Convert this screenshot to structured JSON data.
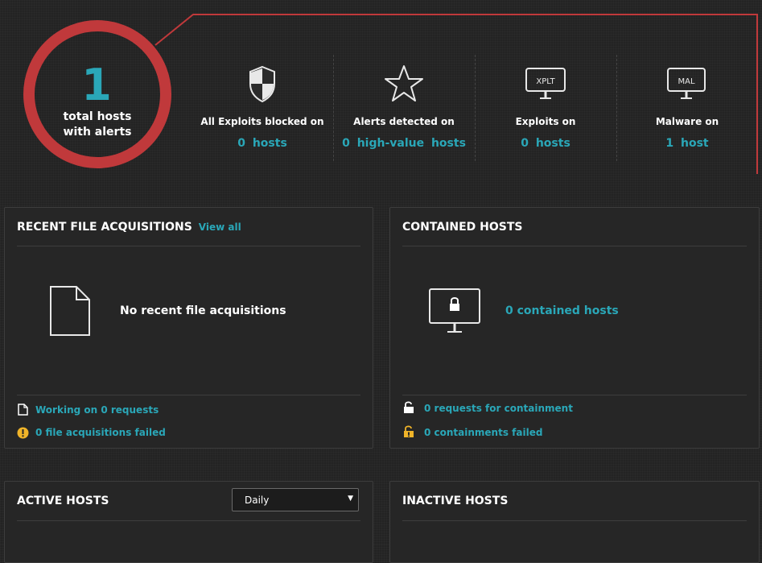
{
  "summary": {
    "total_count": "1",
    "total_label": "total hosts with alerts",
    "stats": [
      {
        "icon": "shield-icon",
        "label": "All Exploits blocked on",
        "value": "0  hosts"
      },
      {
        "icon": "star-icon",
        "label": "Alerts detected on",
        "value": "0  high-value hosts"
      },
      {
        "icon": "xplt-monitor-icon",
        "icon_text": "XPLT",
        "label": "Exploits on",
        "value": "0  hosts"
      },
      {
        "icon": "mal-monitor-icon",
        "icon_text": "MAL",
        "label": "Malware on",
        "value": "1  host"
      }
    ]
  },
  "recent_file": {
    "title": "RECENT FILE ACQUISITIONS",
    "view_all": "View all",
    "empty_message": "No recent file acquisitions",
    "working_on": "Working on 0 requests",
    "failed": "0 file acquisitions failed"
  },
  "contained": {
    "title": "CONTAINED HOSTS",
    "count_text": "0 contained hosts",
    "requests": "0 requests for containment",
    "failed": "0 containments failed"
  },
  "active_hosts": {
    "title": "ACTIVE HOSTS",
    "period": "Daily"
  },
  "inactive_hosts": {
    "title": "INACTIVE HOSTS"
  },
  "colors": {
    "accent": "#2aa7b8",
    "alert_red": "#c0393b",
    "warning": "#f0b429",
    "background": "#232323"
  }
}
